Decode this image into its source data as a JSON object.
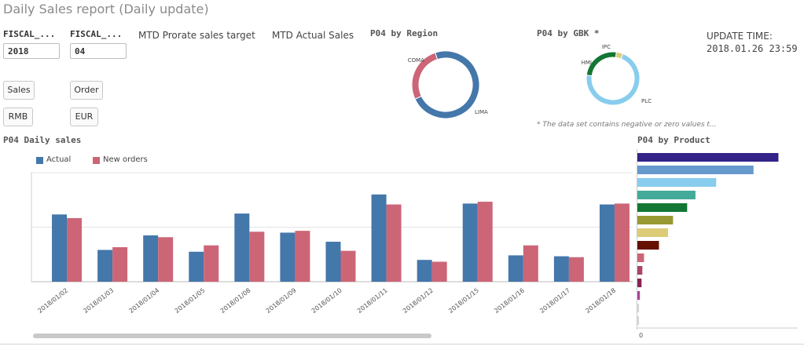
{
  "header": {
    "title": "Daily Sales report (Daily update)"
  },
  "filters": [
    {
      "label": "FISCAL_...",
      "value": "2018"
    },
    {
      "label": "FISCAL_...",
      "value": "04"
    }
  ],
  "buttons": {
    "sales": "Sales",
    "order": "Order",
    "rmb": "RMB",
    "eur": "EUR"
  },
  "kpis": {
    "prorate_title": "MTD Prorate sales target",
    "actual_title": "MTD Actual Sales"
  },
  "update": {
    "label": "UPDATE TIME:",
    "value": "2018.01.26 23:59"
  },
  "note": "* The data set contains negative or zero values t...",
  "colors": {
    "actual": "#4477aa",
    "new_orders": "#cc6677",
    "lima": "#4477aa",
    "coma": "#cc6677",
    "plc": "#88ccee",
    "hmi": "#117733",
    "ipc": "#ddcc77",
    "products": [
      "#332288",
      "#6699cc",
      "#88ccee",
      "#44aa99",
      "#117733",
      "#999933",
      "#ddcc77",
      "#661100",
      "#cc6677",
      "#aa4466",
      "#882255",
      "#aa4499",
      "#d8d8d8",
      "#d8d8d8"
    ]
  },
  "chart_data": [
    {
      "type": "pie",
      "title": "P04 by Region",
      "labels": [
        "LIMA",
        "COMA"
      ],
      "values": [
        73,
        27
      ]
    },
    {
      "type": "pie",
      "title": "P04 by GBK *",
      "labels": [
        "PLC",
        "HMI",
        "IPC"
      ],
      "values": [
        71,
        25,
        4
      ]
    },
    {
      "type": "bar",
      "title": "P04 Daily sales",
      "categories": [
        "2018/01/02",
        "2018/01/03",
        "2018/01/04",
        "2018/01/05",
        "2018/01/08",
        "2018/01/09",
        "2018/01/10",
        "2018/01/11",
        "2018/01/12",
        "2018/01/15",
        "2018/01/16",
        "2018/01/17",
        "2018/01/18"
      ],
      "series": [
        {
          "name": "Actual",
          "values": [
            74,
            35,
            51,
            33,
            75,
            54,
            44,
            96,
            24,
            86,
            29,
            28,
            85
          ]
        },
        {
          "name": "New orders",
          "values": [
            70,
            38,
            49,
            40,
            55,
            56,
            34,
            85,
            22,
            88,
            40,
            27,
            86
          ]
        }
      ],
      "ylim": [
        0,
        120
      ],
      "grid": true,
      "legend": "top-left"
    },
    {
      "type": "bar",
      "orientation": "horizontal",
      "title": "P04 by Product",
      "values": [
        170,
        140,
        95,
        70,
        60,
        43,
        37,
        26,
        8,
        6,
        5,
        3,
        2,
        2
      ],
      "tick_labels": [
        "0"
      ]
    }
  ]
}
